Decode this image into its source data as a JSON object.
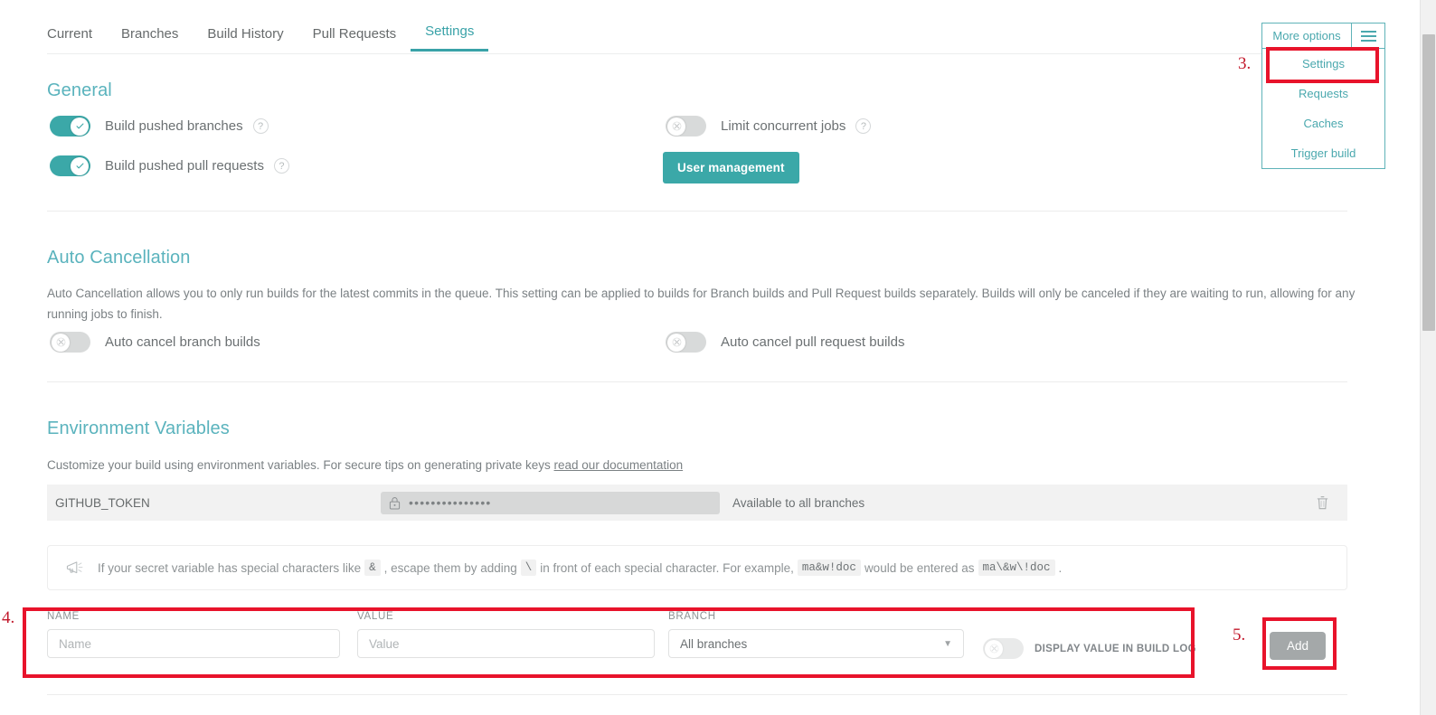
{
  "tabs": [
    {
      "label": "Current",
      "active": false
    },
    {
      "label": "Branches",
      "active": false
    },
    {
      "label": "Build History",
      "active": false
    },
    {
      "label": "Pull Requests",
      "active": false
    },
    {
      "label": "Settings",
      "active": true
    }
  ],
  "more_options": {
    "title": "More options",
    "burger_icon": "hamburger-menu-icon",
    "items": [
      {
        "label": "Settings"
      },
      {
        "label": "Requests"
      },
      {
        "label": "Caches"
      },
      {
        "label": "Trigger build"
      }
    ]
  },
  "general": {
    "title": "General",
    "options": [
      {
        "label": "Build pushed branches",
        "state": "on",
        "help": "?"
      },
      {
        "label": "Build pushed pull requests",
        "state": "on",
        "help": "?"
      },
      {
        "label": "Limit concurrent jobs",
        "state": "off",
        "help": "?"
      }
    ],
    "user_management_label": "User management"
  },
  "auto_cancellation": {
    "title": "Auto Cancellation",
    "description_line1": "Auto Cancellation allows you to only run builds for the latest commits in the queue. This setting can be applied to builds for Branch builds and Pull Request builds separately. Builds will only be canceled if they are waiting to run, allowing for any running jobs",
    "description_line2": "to finish.",
    "options": [
      {
        "label": "Auto cancel branch builds",
        "state": "off"
      },
      {
        "label": "Auto cancel pull request builds",
        "state": "off"
      }
    ]
  },
  "environment_variables": {
    "title": "Environment Variables",
    "description": "Customize your build using environment variables. For secure tips on generating private keys ",
    "doc_link": "read our documentation",
    "row": {
      "name": "GITHUB_TOKEN",
      "lock_icon": "lock-icon",
      "masked_value": "•••••••••••••••",
      "branch": "Available to all branches",
      "delete_icon": "trash-icon"
    },
    "notice": {
      "icon": "megaphone-icon",
      "part1": "If your secret variable has special characters like",
      "code1": "&",
      "part2": ", escape them by adding",
      "code2": "\\",
      "part3": "in front of each special character. For example,",
      "code3": "ma&w!doc",
      "part4": "would be entered as",
      "code4": "ma\\&w\\!doc",
      "part5": "."
    },
    "form": {
      "name_label": "NAME",
      "name_placeholder": "Name",
      "name_value": "",
      "value_label": "VALUE",
      "value_placeholder": "Value",
      "value_value": "",
      "branch_label": "BRANCH",
      "branch_selected": "All branches",
      "branch_caret": "chevron-down-icon",
      "display_toggle_state": "off",
      "display_label": "DISPLAY VALUE IN BUILD LOG",
      "add_label": "Add"
    }
  },
  "annotations": [
    {
      "number": "3."
    },
    {
      "number": "4."
    },
    {
      "number": "5."
    }
  ],
  "colors": {
    "accent_teal": "#3ba8a8",
    "heading_teal": "#5ab3bd",
    "annotation_red": "#e8132b",
    "toggle_off": "#d8dada"
  }
}
